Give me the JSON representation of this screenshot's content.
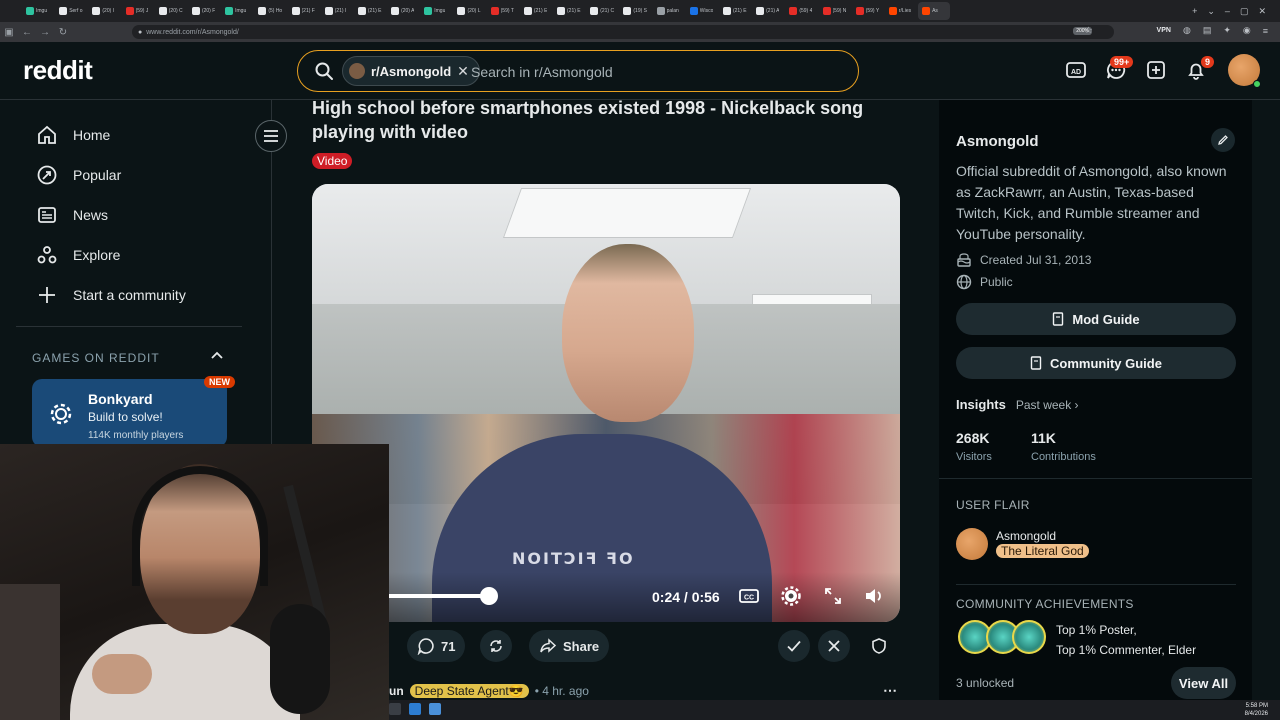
{
  "browser": {
    "tabs": [
      {
        "label": "Imgu",
        "color": "#2ec4a0"
      },
      {
        "label": "Serf o",
        "color": "#e8eaed"
      },
      {
        "label": "(20) I",
        "color": "#e8eaed"
      },
      {
        "label": "(59) J",
        "color": "#e52d27"
      },
      {
        "label": "(20) C",
        "color": "#e8eaed"
      },
      {
        "label": "(20) F",
        "color": "#e8eaed"
      },
      {
        "label": "Imgu",
        "color": "#2ec4a0"
      },
      {
        "label": "(5) Ho",
        "color": "#e8eaed"
      },
      {
        "label": "(21) F",
        "color": "#e8eaed"
      },
      {
        "label": "(21) I",
        "color": "#e8eaed"
      },
      {
        "label": "(21) E",
        "color": "#e8eaed"
      },
      {
        "label": "(20) A",
        "color": "#e8eaed"
      },
      {
        "label": "Imgu",
        "color": "#2ec4a0"
      },
      {
        "label": "(20) L",
        "color": "#e8eaed"
      },
      {
        "label": "(59) T",
        "color": "#e52d27"
      },
      {
        "label": "(21) E",
        "color": "#e8eaed"
      },
      {
        "label": "(21) E",
        "color": "#e8eaed"
      },
      {
        "label": "(21) C",
        "color": "#e8eaed"
      },
      {
        "label": "(19) S",
        "color": "#e8eaed"
      },
      {
        "label": "palan",
        "color": "#9aa0a6"
      },
      {
        "label": "Wisco",
        "color": "#1a73e8"
      },
      {
        "label": "(21) E",
        "color": "#e8eaed"
      },
      {
        "label": "(21) A",
        "color": "#e8eaed"
      },
      {
        "label": "(59) 4",
        "color": "#e52d27"
      },
      {
        "label": "(59) N",
        "color": "#e52d27"
      },
      {
        "label": "(59) Y",
        "color": "#e52d27"
      },
      {
        "label": "r/Lies",
        "color": "#ff4500"
      },
      {
        "label": "As",
        "color": "#ff4500",
        "active": true
      }
    ],
    "url": "www.reddit.com/r/Asmongold/",
    "zoom": "200%",
    "vpn": "VPN"
  },
  "header": {
    "logo": "reddit",
    "search_chip": "r/Asmongold",
    "search_placeholder": "Search in r/Asmongold",
    "chat_badge": "99+",
    "notif_badge": "9"
  },
  "left_nav": {
    "items": [
      {
        "label": "Home",
        "icon": "home-icon"
      },
      {
        "label": "Popular",
        "icon": "popular-icon"
      },
      {
        "label": "News",
        "icon": "news-icon"
      },
      {
        "label": "Explore",
        "icon": "explore-icon"
      },
      {
        "label": "Start a community",
        "icon": "plus-icon"
      }
    ],
    "games_title": "GAMES ON REDDIT",
    "game": {
      "name": "Bonkyard",
      "subtitle": "Build to solve!",
      "players": "114K monthly players",
      "badge": "NEW"
    }
  },
  "post": {
    "title": "High school before smartphones existed 1998 - Nickelback song playing with video",
    "flair": "Video",
    "video": {
      "time": "0:24 / 0:56",
      "shirt_text": "NOITƆIꟻ ꟻO"
    },
    "comments_count": "71",
    "share_label": "Share"
  },
  "comment": {
    "user": "un",
    "flair": "Deep State Agent😎",
    "time": "4 hr. ago"
  },
  "community": {
    "name": "Asmongold",
    "description": "Official subreddit of Asmongold, also known as ZackRawrr, an Austin, Texas-based Twitch, Kick, and Rumble streamer and YouTube personality.",
    "created": "Created Jul 31, 2013",
    "visibility": "Public",
    "mod_guide": "Mod Guide",
    "community_guide": "Community Guide",
    "insights_label": "Insights",
    "insights_period": "Past week",
    "visitors_value": "268K",
    "visitors_label": "Visitors",
    "contrib_value": "11K",
    "contrib_label": "Contributions",
    "user_flair_title": "USER FLAIR",
    "flair_user": "Asmongold",
    "flair_tag": "The Literal God",
    "achievements_title": "COMMUNITY ACHIEVEMENTS",
    "ach_line1": "Top 1% Poster,",
    "ach_line2": "Top 1% Commenter, Elder",
    "unlocked": "3 unlocked",
    "view_all": "View All"
  },
  "taskbar": {
    "time": "5:58 PM",
    "date": "8/4/2026"
  },
  "colors": {
    "accent_orange": "#ff4500",
    "search_border": "#e8a020",
    "flair_video": "#cf1d26",
    "game_card": "#1a4a78"
  }
}
